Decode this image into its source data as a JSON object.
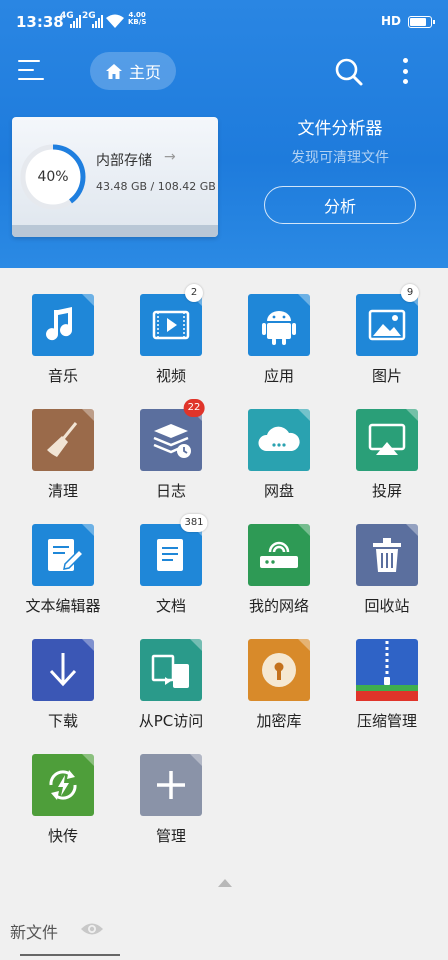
{
  "status_bar": {
    "time": "13:38",
    "signal_1": "4G",
    "signal_2": "2G",
    "speed_value": "4.00",
    "speed_unit": "KB/S",
    "hd": "HD"
  },
  "header": {
    "home_label": "主页",
    "storage": {
      "name": "内部存储",
      "percent": "40%",
      "percent_value": 40,
      "size": "43.48 GB / 108.42 GB"
    },
    "analyzer": {
      "title": "文件分析器",
      "subtitle": "发现可清理文件",
      "button": "分析"
    }
  },
  "grid": {
    "items": [
      {
        "label": "音乐",
        "icon": "music-icon",
        "color": "#1f87d8"
      },
      {
        "label": "视频",
        "icon": "video-icon",
        "color": "#1f87d8",
        "badge": "2"
      },
      {
        "label": "应用",
        "icon": "android-icon",
        "color": "#1f87d8"
      },
      {
        "label": "图片",
        "icon": "image-icon",
        "color": "#1f87d8",
        "badge": "9"
      },
      {
        "label": "清理",
        "icon": "broom-icon",
        "color": "#9a6a4a"
      },
      {
        "label": "日志",
        "icon": "log-icon",
        "color": "#5b6f9e",
        "badge": "22",
        "badge_color": "red"
      },
      {
        "label": "网盘",
        "icon": "cloud-icon",
        "color": "#2aa2b0"
      },
      {
        "label": "投屏",
        "icon": "cast-icon",
        "color": "#2a9f78"
      },
      {
        "label": "文本编辑器",
        "icon": "editor-icon",
        "color": "#1f87d8"
      },
      {
        "label": "文档",
        "icon": "document-icon",
        "color": "#1f87d8",
        "badge": "381"
      },
      {
        "label": "我的网络",
        "icon": "router-icon",
        "color": "#2e9a55"
      },
      {
        "label": "回收站",
        "icon": "trash-icon",
        "color": "#5b6f9e"
      },
      {
        "label": "下载",
        "icon": "download-icon",
        "color": "#3b57b5"
      },
      {
        "label": "从PC访问",
        "icon": "pc-access-icon",
        "color": "#2a9a8a"
      },
      {
        "label": "加密库",
        "icon": "lock-icon",
        "color": "#d88a2a"
      },
      {
        "label": "压缩管理",
        "icon": "zip-icon",
        "color": "#2f63c6"
      },
      {
        "label": "快传",
        "icon": "quick-send-icon",
        "color": "#4e9e3a"
      },
      {
        "label": "管理",
        "icon": "add-icon",
        "color": "#8a93a8"
      }
    ]
  },
  "recent": {
    "title": "新文件"
  }
}
